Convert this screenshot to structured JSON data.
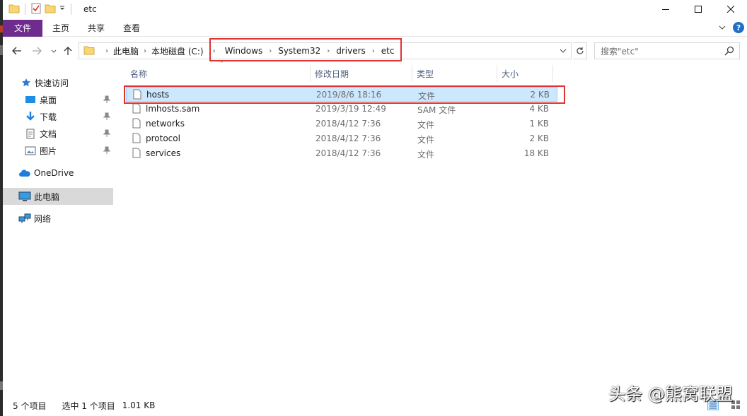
{
  "window": {
    "title": "etc"
  },
  "ribbon": {
    "tabs": [
      "文件",
      "主页",
      "共享",
      "查看"
    ]
  },
  "nav": {
    "breadcrumbs": [
      "此电脑",
      "本地磁盘 (C:)",
      "Windows",
      "System32",
      "drivers",
      "etc"
    ],
    "search_placeholder": "搜索\"etc\""
  },
  "sidebar": {
    "items": [
      {
        "label": "快速访问",
        "icon": "star-icon"
      },
      {
        "label": "桌面",
        "icon": "desktop-icon",
        "pinned": true
      },
      {
        "label": "下载",
        "icon": "download-icon",
        "pinned": true
      },
      {
        "label": "文档",
        "icon": "document-icon",
        "pinned": true
      },
      {
        "label": "图片",
        "icon": "picture-icon",
        "pinned": true
      },
      {
        "label": "OneDrive",
        "icon": "cloud-icon"
      },
      {
        "label": "此电脑",
        "icon": "computer-icon",
        "selected": true
      },
      {
        "label": "网络",
        "icon": "network-icon"
      }
    ]
  },
  "columns": [
    "名称",
    "修改日期",
    "类型",
    "大小"
  ],
  "files": [
    {
      "name": "hosts",
      "date": "2019/8/6 18:16",
      "type": "文件",
      "size": "2 KB",
      "selected": true
    },
    {
      "name": "lmhosts.sam",
      "date": "2019/3/19 12:49",
      "type": "SAM 文件",
      "size": "4 KB"
    },
    {
      "name": "networks",
      "date": "2018/4/12 7:36",
      "type": "文件",
      "size": "1 KB"
    },
    {
      "name": "protocol",
      "date": "2018/4/12 7:36",
      "type": "文件",
      "size": "2 KB"
    },
    {
      "name": "services",
      "date": "2018/4/12 7:36",
      "type": "文件",
      "size": "18 KB"
    }
  ],
  "status": {
    "count": "5 个项目",
    "selection": "选中 1 个项目",
    "size": "1.01 KB"
  },
  "watermark": "头条 @熊窝联盟",
  "colors": {
    "file_tab": "#6e2c8e",
    "selection": "#cce8ff",
    "highlight": "#e03232"
  }
}
